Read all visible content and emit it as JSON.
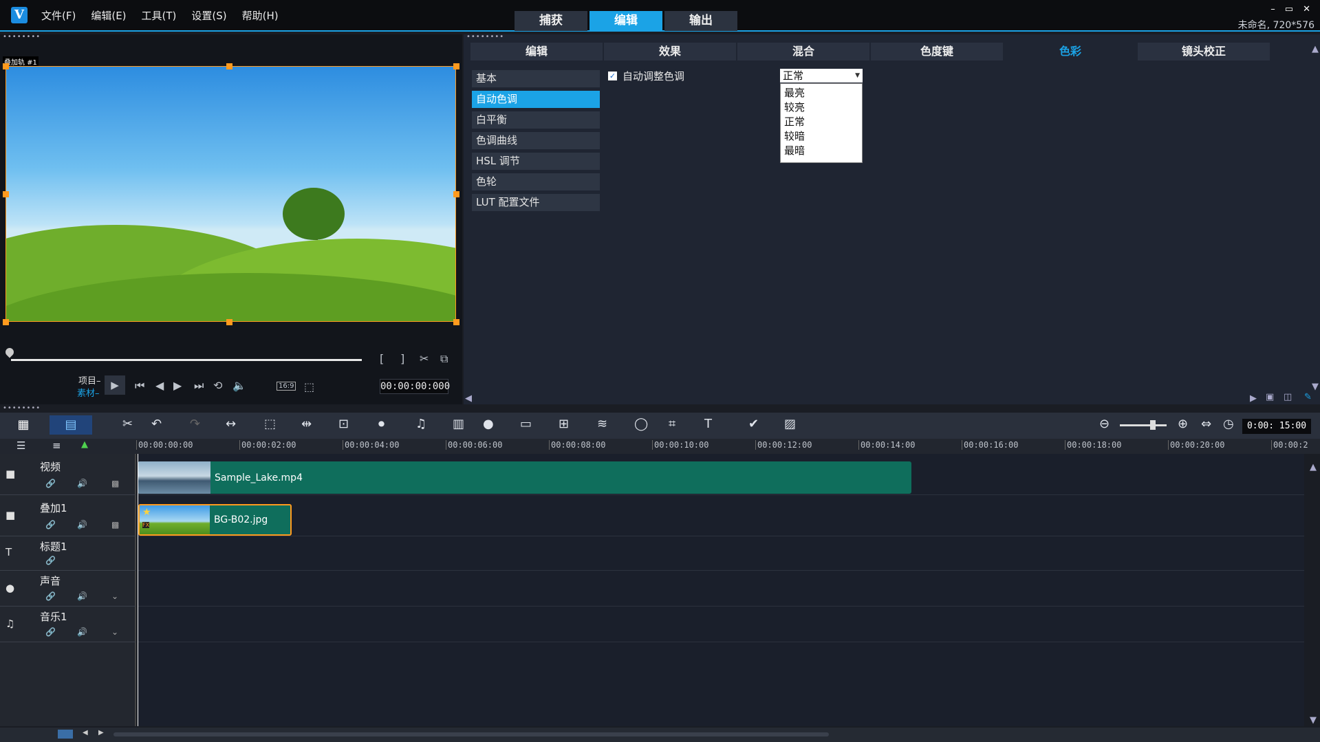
{
  "app": {
    "logo_letter": "V",
    "menu": [
      "文件(F)",
      "编辑(E)",
      "工具(T)",
      "设置(S)",
      "帮助(H)"
    ],
    "modes": [
      "捕获",
      "编辑",
      "输出"
    ],
    "active_mode": "编辑",
    "project_info": "未命名, 720*576",
    "window_controls": [
      "–",
      "▭",
      "✕"
    ]
  },
  "preview": {
    "overlay_label": "叠加轨 #1",
    "project_label": "项目–",
    "clip_label": "素材–",
    "aspect_ratio": "16:9",
    "timecode": "00:00:00:000"
  },
  "options": {
    "tabs": [
      "编辑",
      "效果",
      "混合",
      "色度键",
      "色彩",
      "镜头校正"
    ],
    "active_tab": "色彩",
    "categories": [
      "基本",
      "自动色调",
      "白平衡",
      "色调曲线",
      "HSL 调节",
      "色轮",
      "LUT 配置文件"
    ],
    "active_category": "自动色调",
    "auto_tone_label": "自动调整色调",
    "auto_tone_checked": true,
    "tone_select_value": "正常",
    "tone_options": [
      "最亮",
      "较亮",
      "正常",
      "较暗",
      "最暗"
    ]
  },
  "timeline": {
    "duration": "0:00: 15:00",
    "ruler": [
      "00:00:00:00",
      "00:00:02:00",
      "00:00:04:00",
      "00:00:06:00",
      "00:00:08:00",
      "00:00:10:00",
      "00:00:12:00",
      "00:00:14:00",
      "00:00:16:00",
      "00:00:18:00",
      "00:00:20:00",
      "00:00:2"
    ],
    "tracks": [
      {
        "name": "视频",
        "icon": "video-camera-icon"
      },
      {
        "name": "叠加1",
        "icon": "overlay-camera-icon"
      },
      {
        "name": "标题1",
        "icon": "title-icon"
      },
      {
        "name": "声音",
        "icon": "microphone-icon"
      },
      {
        "name": "音乐1",
        "icon": "music-note-icon"
      }
    ],
    "clips": [
      {
        "name": "Sample_Lake.mp4",
        "track": "视频",
        "start_s": 0,
        "end_s": 15.0
      },
      {
        "name": "BG-B02.jpg",
        "track": "叠加1",
        "start_s": 0,
        "end_s": 3.0
      }
    ]
  },
  "colors": {
    "accent": "#1ba3e6",
    "clip": "#0f6e5c",
    "selection": "#ff9a1e"
  }
}
